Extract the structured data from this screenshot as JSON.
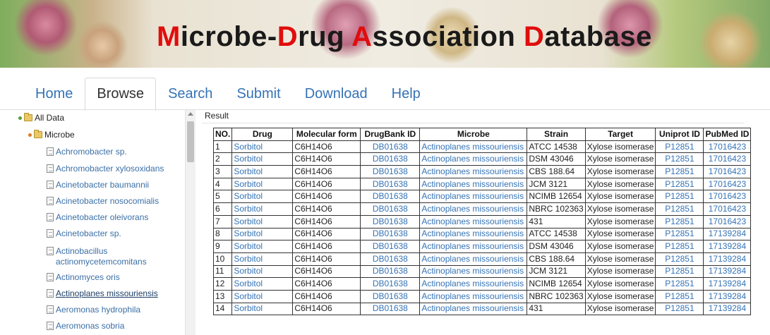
{
  "banner": {
    "title_parts": [
      {
        "text": "M",
        "red": true
      },
      {
        "text": "icrobe-",
        "red": false
      },
      {
        "text": "D",
        "red": true
      },
      {
        "text": "rug ",
        "red": false
      },
      {
        "text": "A",
        "red": true
      },
      {
        "text": "ssociation ",
        "red": false
      },
      {
        "text": "D",
        "red": true
      },
      {
        "text": "atabase",
        "red": false
      }
    ],
    "accent_color": "#e00d0d"
  },
  "tabs": [
    {
      "label": "Home",
      "active": false
    },
    {
      "label": "Browse",
      "active": true
    },
    {
      "label": "Search",
      "active": false
    },
    {
      "label": "Submit",
      "active": false
    },
    {
      "label": "Download",
      "active": false
    },
    {
      "label": "Help",
      "active": false
    }
  ],
  "tree": {
    "root": "All Data",
    "branch": "Microbe",
    "leaves": [
      {
        "lines": [
          "Achromobacter sp."
        ]
      },
      {
        "lines": [
          "Achromobacter xylosoxidans"
        ]
      },
      {
        "lines": [
          "Acinetobacter baumannii"
        ]
      },
      {
        "lines": [
          "Acinetobacter nosocomialis"
        ]
      },
      {
        "lines": [
          "Acinetobacter oleivorans"
        ]
      },
      {
        "lines": [
          "Acinetobacter sp."
        ]
      },
      {
        "lines": [
          "Actinobacillus",
          "actinomycetemcomitans"
        ]
      },
      {
        "lines": [
          "Actinomyces oris"
        ]
      },
      {
        "lines": [
          "Actinoplanes missouriensis"
        ],
        "selected": true
      },
      {
        "lines": [
          "Aeromonas hydrophila"
        ]
      },
      {
        "lines": [
          "Aeromonas sobria"
        ]
      }
    ]
  },
  "result": {
    "label": "Result",
    "columns": [
      "NO.",
      "Drug",
      "Molecular form",
      "DrugBank ID",
      "Microbe",
      "Strain",
      "Target",
      "Uniprot ID",
      "PubMed ID"
    ],
    "rows": [
      [
        "1",
        "Sorbitol",
        "C6H14O6",
        "DB01638",
        "Actinoplanes missouriensis",
        "ATCC 14538",
        "Xylose isomerase",
        "P12851",
        "17016423"
      ],
      [
        "2",
        "Sorbitol",
        "C6H14O6",
        "DB01638",
        "Actinoplanes missouriensis",
        "DSM 43046",
        "Xylose isomerase",
        "P12851",
        "17016423"
      ],
      [
        "3",
        "Sorbitol",
        "C6H14O6",
        "DB01638",
        "Actinoplanes missouriensis",
        "CBS 188.64",
        "Xylose isomerase",
        "P12851",
        "17016423"
      ],
      [
        "4",
        "Sorbitol",
        "C6H14O6",
        "DB01638",
        "Actinoplanes missouriensis",
        "JCM 3121",
        "Xylose isomerase",
        "P12851",
        "17016423"
      ],
      [
        "5",
        "Sorbitol",
        "C6H14O6",
        "DB01638",
        "Actinoplanes missouriensis",
        "NCIMB 12654",
        "Xylose isomerase",
        "P12851",
        "17016423"
      ],
      [
        "6",
        "Sorbitol",
        "C6H14O6",
        "DB01638",
        "Actinoplanes missouriensis",
        "NBRC 102363",
        "Xylose isomerase",
        "P12851",
        "17016423"
      ],
      [
        "7",
        "Sorbitol",
        "C6H14O6",
        "DB01638",
        "Actinoplanes missouriensis",
        "431",
        "Xylose isomerase",
        "P12851",
        "17016423"
      ],
      [
        "8",
        "Sorbitol",
        "C6H14O6",
        "DB01638",
        "Actinoplanes missouriensis",
        "ATCC 14538",
        "Xylose isomerase",
        "P12851",
        "17139284"
      ],
      [
        "9",
        "Sorbitol",
        "C6H14O6",
        "DB01638",
        "Actinoplanes missouriensis",
        "DSM 43046",
        "Xylose isomerase",
        "P12851",
        "17139284"
      ],
      [
        "10",
        "Sorbitol",
        "C6H14O6",
        "DB01638",
        "Actinoplanes missouriensis",
        "CBS 188.64",
        "Xylose isomerase",
        "P12851",
        "17139284"
      ],
      [
        "11",
        "Sorbitol",
        "C6H14O6",
        "DB01638",
        "Actinoplanes missouriensis",
        "JCM 3121",
        "Xylose isomerase",
        "P12851",
        "17139284"
      ],
      [
        "12",
        "Sorbitol",
        "C6H14O6",
        "DB01638",
        "Actinoplanes missouriensis",
        "NCIMB 12654",
        "Xylose isomerase",
        "P12851",
        "17139284"
      ],
      [
        "13",
        "Sorbitol",
        "C6H14O6",
        "DB01638",
        "Actinoplanes missouriensis",
        "NBRC 102363",
        "Xylose isomerase",
        "P12851",
        "17139284"
      ],
      [
        "14",
        "Sorbitol",
        "C6H14O6",
        "DB01638",
        "Actinoplanes missouriensis",
        "431",
        "Xylose isomerase",
        "P12851",
        "17139284"
      ]
    ]
  },
  "colors": {
    "link": "#3573b5",
    "tree_link": "#3b6fa6",
    "tab_active": "#333333"
  }
}
